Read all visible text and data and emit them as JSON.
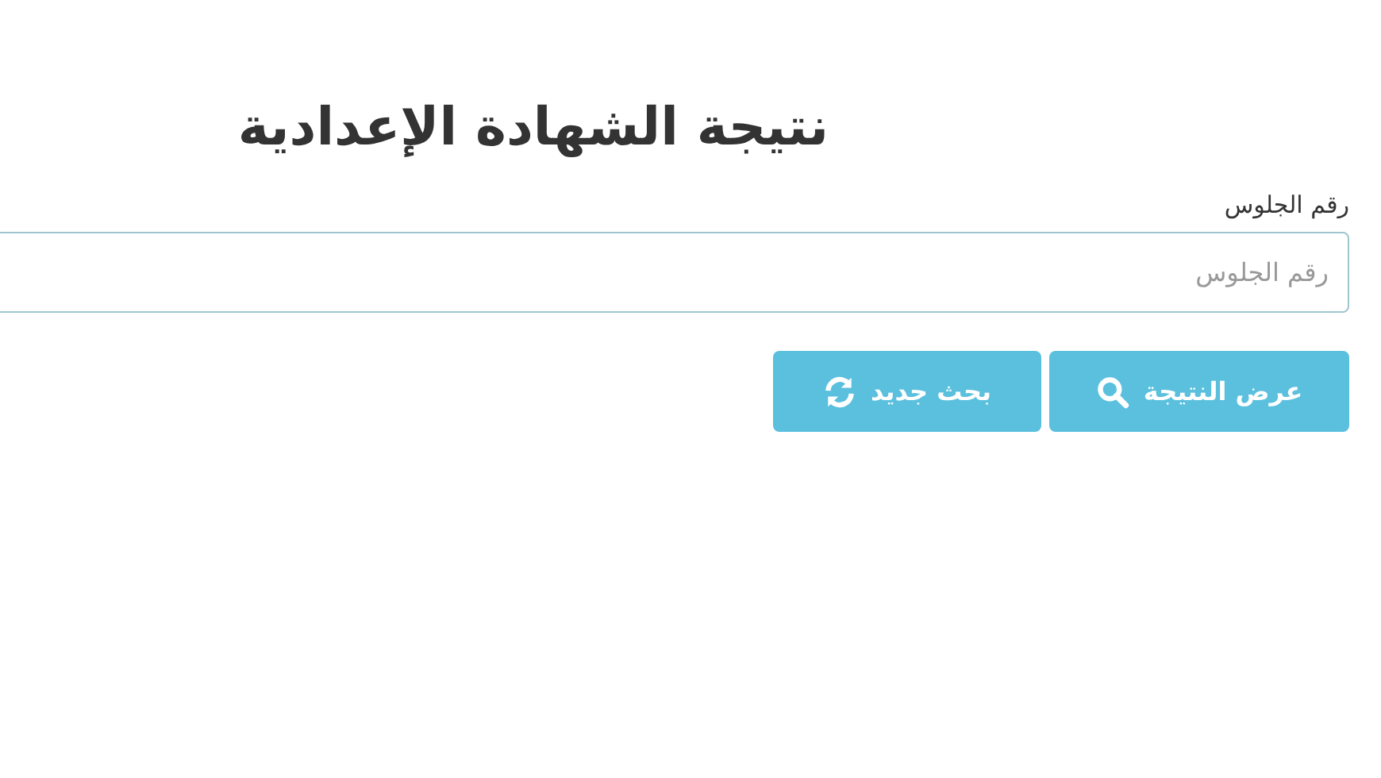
{
  "title": "نتيجة الشهادة الإعدادية",
  "seat_number": {
    "label": "رقم الجلوس",
    "placeholder": "رقم الجلوس"
  },
  "buttons": [
    {
      "kind": "search",
      "label": "عرض النتيجة"
    },
    {
      "kind": "refresh",
      "label": "بحث جديد"
    }
  ]
}
